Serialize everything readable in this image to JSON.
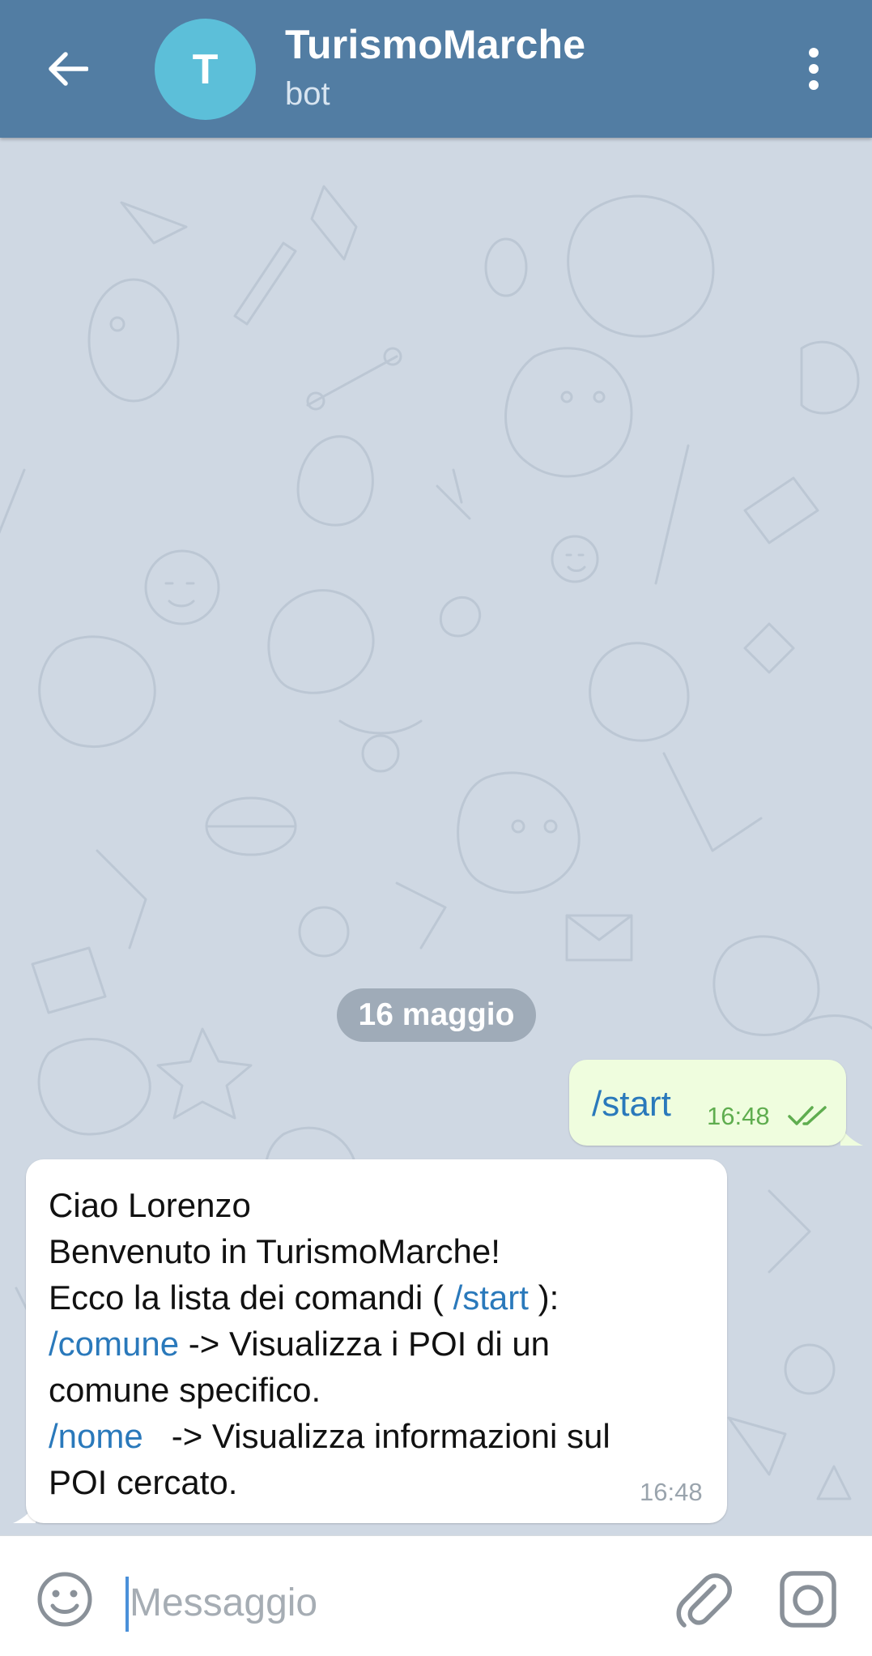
{
  "header": {
    "back_icon": "arrow-left-icon",
    "avatar_letter": "T",
    "title": "TurismoMarche",
    "subtitle": "bot",
    "menu_icon": "more-vertical-icon",
    "bg_color": "#527da3",
    "avatar_color": "#5cbfd9"
  },
  "chat": {
    "date_label": "16 maggio",
    "outgoing": {
      "text": "/start",
      "time": "16:48",
      "status_icon": "double-check-icon"
    },
    "incoming": {
      "line1": "Ciao Lorenzo",
      "line2": "Benvenuto in TurismoMarche!",
      "line3_pre": "Ecco la lista dei comandi ( ",
      "line3_cmd": "/start",
      "line3_post": " ):",
      "line4_cmd": "/comune",
      "line4_post": " -> Visualizza i POI di un",
      "line5": "comune specifico.",
      "line6_cmd": "/nome",
      "line6_post": "   -> Visualizza informazioni sul",
      "line7": "POI cercato.",
      "time": "16:48"
    }
  },
  "input_bar": {
    "placeholder": "Messaggio",
    "emoji_icon": "smiley-icon",
    "attach_icon": "paperclip-icon",
    "camera_icon": "camera-icon"
  },
  "colors": {
    "link": "#2a79bb",
    "outgoing_bubble": "#effdde",
    "chat_background": "#cfd8e3"
  }
}
